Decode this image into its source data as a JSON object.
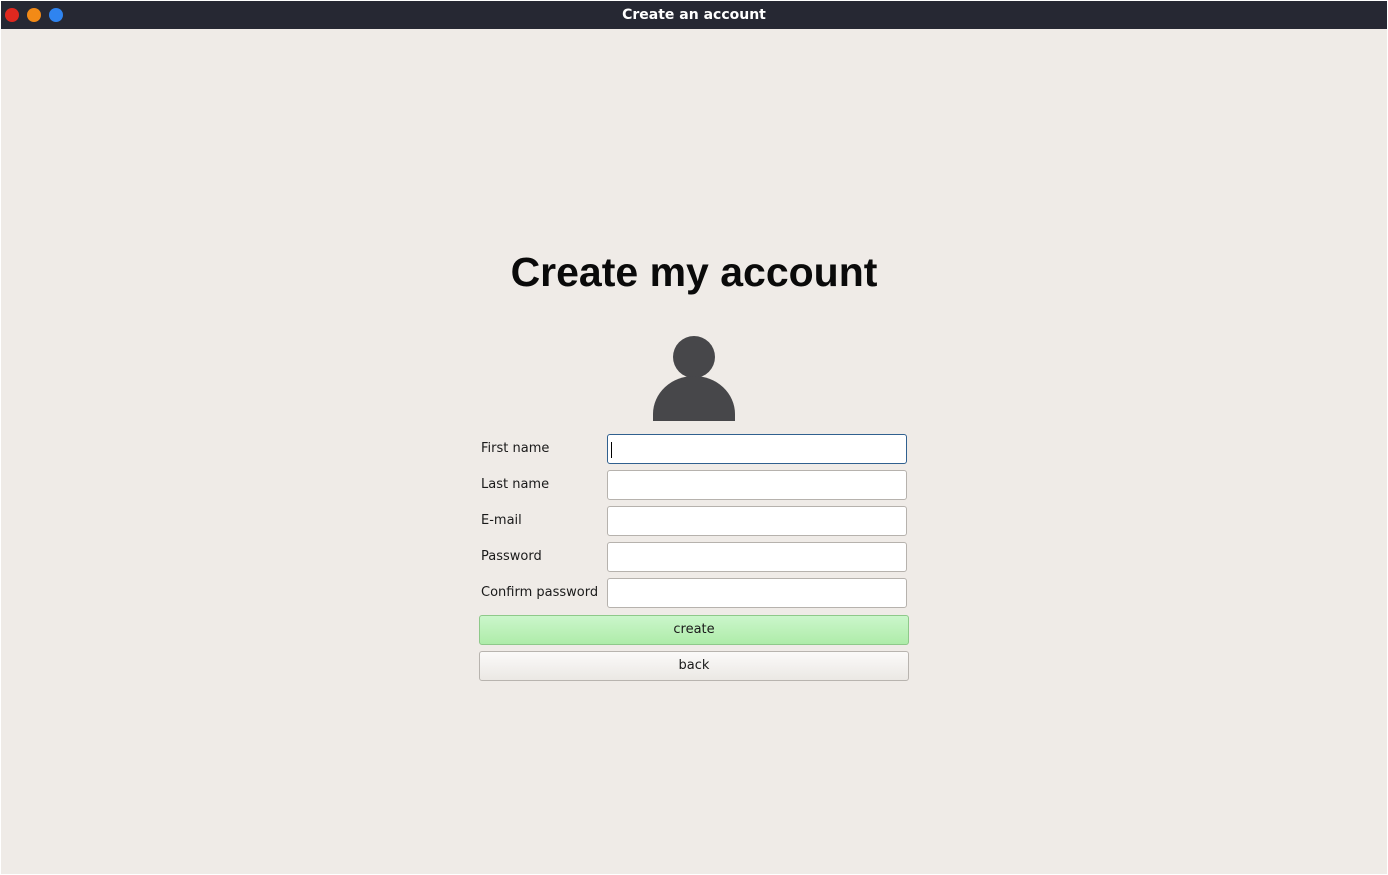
{
  "window": {
    "title": "Create an account"
  },
  "form": {
    "heading": "Create my account",
    "avatar_icon": "user-avatar-icon",
    "fields": [
      {
        "label": "First name",
        "value": "",
        "focused": true
      },
      {
        "label": "Last name",
        "value": ""
      },
      {
        "label": "E-mail",
        "value": ""
      },
      {
        "label": "Password",
        "value": ""
      },
      {
        "label": "Confirm password",
        "value": ""
      }
    ],
    "create_label": "create",
    "back_label": "back"
  },
  "colors": {
    "titlebar": "#262833",
    "background": "#efebe7",
    "create_button": "#b8f0b4",
    "close": "#e0281f",
    "minimize": "#f28a16",
    "maximize": "#2f84f0"
  }
}
